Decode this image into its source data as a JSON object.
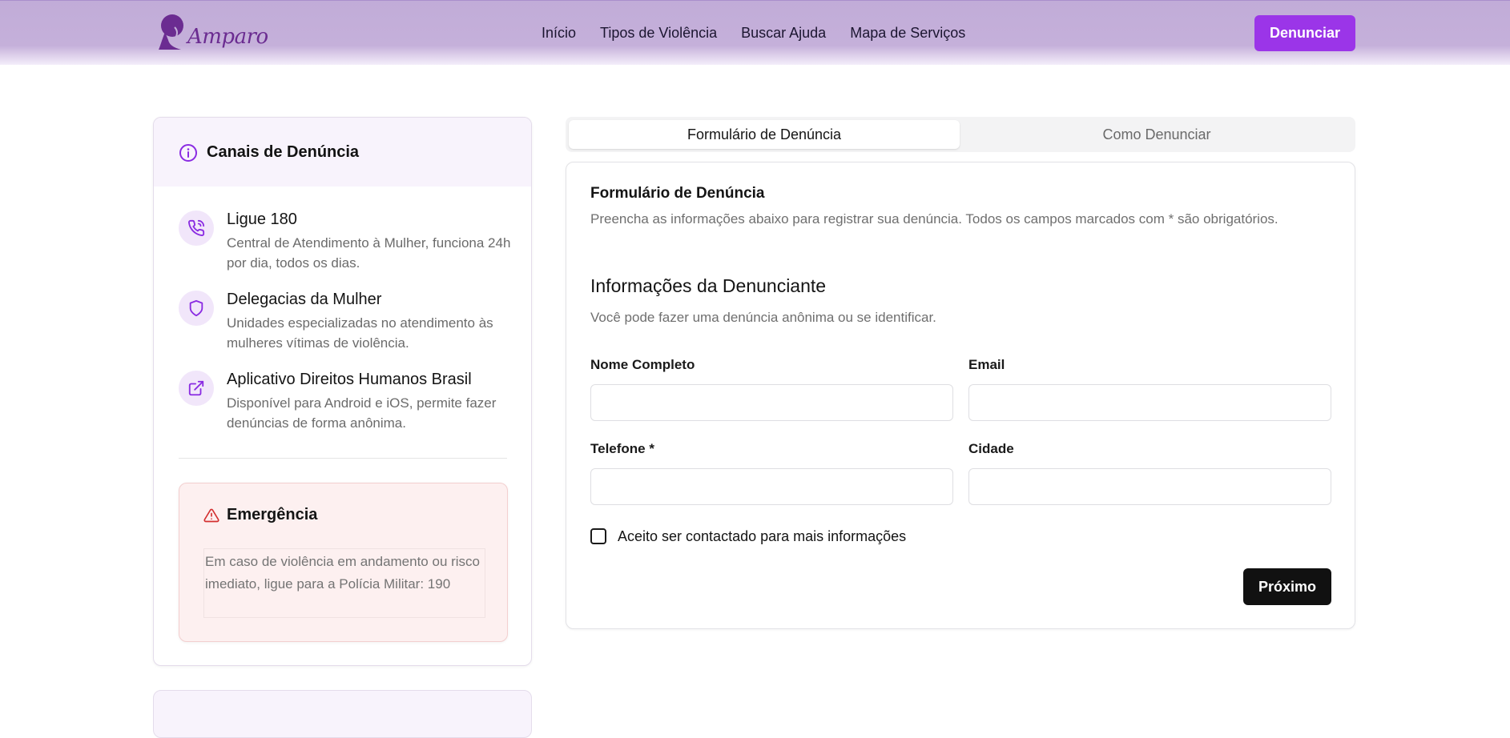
{
  "brand": {
    "name": "Amparo"
  },
  "nav": {
    "links": [
      "Início",
      "Tipos de Violência",
      "Buscar Ajuda",
      "Mapa de Serviços"
    ],
    "cta_label": "Denunciar"
  },
  "sidebar": {
    "title": "Canais de Denúncia",
    "channels": [
      {
        "icon": "phone-icon",
        "title": "Ligue 180",
        "desc": "Central de Atendimento à Mulher, funciona 24h por dia, todos os dias."
      },
      {
        "icon": "shield-icon",
        "title": "Delegacias da Mulher",
        "desc": "Unidades especializadas no atendimento às mulheres vítimas de violência."
      },
      {
        "icon": "external-link-icon",
        "title": "Aplicativo Direitos Humanos Brasil",
        "desc": "Disponível para Android e iOS, permite fazer denúncias de forma anônima."
      }
    ],
    "emergency": {
      "title": "Emergência",
      "text": "Em caso de violência em andamento ou risco imediato, ligue para a Polícia Militar: 190"
    }
  },
  "tabs": [
    {
      "label": "Formulário de Denúncia",
      "active": true
    },
    {
      "label": "Como Denunciar",
      "active": false
    }
  ],
  "form": {
    "title": "Formulário de Denúncia",
    "description": "Preencha as informações abaixo para registrar sua denúncia. Todos os campos marcados com * são obrigatórios.",
    "section_title": "Informações da Denunciante",
    "section_desc": "Você pode fazer uma denúncia anônima ou se identificar.",
    "fields": {
      "nome": {
        "label": "Nome Completo",
        "value": ""
      },
      "email": {
        "label": "Email",
        "value": ""
      },
      "telefone": {
        "label": "Telefone *",
        "value": ""
      },
      "cidade": {
        "label": "Cidade",
        "value": ""
      }
    },
    "checkbox_label": "Aceito ser contactado para mais informações",
    "checkbox_checked": false,
    "next_label": "Próximo"
  },
  "colors": {
    "accent": "#9b35e8",
    "header_bg": "#c5b0da",
    "icon_purple": "#8a2be2",
    "emergency_red": "#d32f2f"
  }
}
